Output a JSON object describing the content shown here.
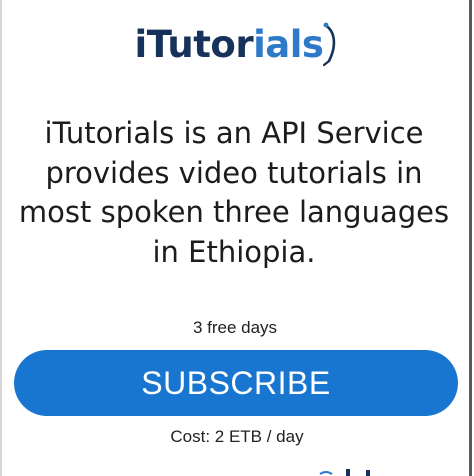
{
  "logo": {
    "part1": "iTutor",
    "part2": "ials",
    "colors": {
      "dark": "#17325a",
      "blue": "#2d7ac8"
    }
  },
  "description": "iTutorials is an API Service provides video tutorials in most spoken three languages in Ethiopia.",
  "trial_text": "3 free days",
  "subscribe_label": "SUBSCRIBE",
  "cost_text": "Cost: 2 ETB / day",
  "colors": {
    "button": "#1876d0",
    "button_text": "#ffffff",
    "text": "#1c1c1c"
  }
}
